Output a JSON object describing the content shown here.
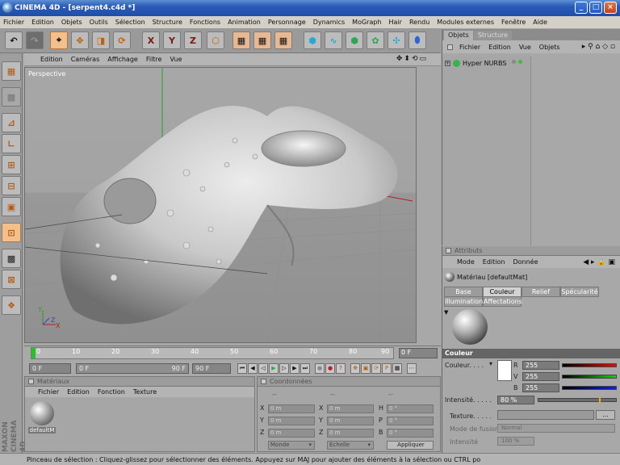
{
  "window": {
    "title": "CINEMA 4D - [serpent4.c4d *]",
    "min": "_",
    "max": "□",
    "close": "×"
  },
  "menubar": [
    "Fichier",
    "Edition",
    "Objets",
    "Outils",
    "Sélection",
    "Structure",
    "Fonctions",
    "Animation",
    "Personnage",
    "Dynamics",
    "MoGraph",
    "Hair",
    "Rendu",
    "Modules externes",
    "Fenêtre",
    "Aide"
  ],
  "toolbar": {
    "x": "X",
    "y": "Y",
    "z": "Z"
  },
  "viewport": {
    "menu": [
      "Edition",
      "Caméras",
      "Affichage",
      "Filtre",
      "Vue"
    ],
    "label": "Perspective",
    "nav": "✥⬍⟲▭"
  },
  "timeline": {
    "ticks": [
      "0",
      "10",
      "20",
      "30",
      "40",
      "50",
      "60",
      "70",
      "80",
      "90"
    ],
    "current_frame": "0 F"
  },
  "transport": {
    "start": "0 F",
    "range_start": "0 F",
    "range_end": "90 F",
    "end": "90 F"
  },
  "materials": {
    "title": "Matériaux",
    "menu": [
      "Fichier",
      "Edition",
      "Fonction",
      "Texture"
    ],
    "item": "defaultM"
  },
  "coords": {
    "title": "Coordonnées",
    "col1": "--",
    "col2": "--",
    "col3": "--",
    "pos": [
      "0 m",
      "0 m",
      "0 m"
    ],
    "size": [
      "0 m",
      "0 m",
      "0 m"
    ],
    "rot": [
      "0 °",
      "0 °",
      "0 °"
    ],
    "labels_left": [
      "X",
      "Y",
      "Z"
    ],
    "labels_mid": [
      "X",
      "Y",
      "Z"
    ],
    "labels_right": [
      "H",
      "P",
      "B"
    ],
    "mode": "Monde",
    "scale": "Echelle",
    "apply": "Appliquer"
  },
  "objects": {
    "tabs": [
      "Objets",
      "Structure"
    ],
    "menu": [
      "Fichier",
      "Edition",
      "Vue",
      "Objets"
    ],
    "item": "Hyper NURBS"
  },
  "attributes": {
    "title": "Attributs",
    "menu": [
      "Mode",
      "Edition",
      "Donnée"
    ],
    "material_name": "Matériau [defaultMat]",
    "tabs_row1": [
      "Base",
      "Couleur",
      "Relief",
      "Spécularité"
    ],
    "tabs_row2": [
      "Illumination",
      "Affectations"
    ],
    "section": "Couleur",
    "color_label": "Couleur. . . .",
    "r_label": "R",
    "v_label": "V",
    "b_label": "B",
    "r": "255",
    "v": "255",
    "b": "255",
    "intensity_label": "Intensité. . . . .",
    "intensity": "80 %",
    "intensity_level": 0.8,
    "texture_label": "Texture. . . . .",
    "texture_btn": "...",
    "blend_label": "Mode de fusion",
    "blend_value": "Normal",
    "blend_int_label": "Intensité",
    "blend_int_value": "100 %"
  },
  "status": "Pinceau de sélection : Cliquez-glissez pour sélectionner des éléments. Appuyez sur MAJ pour ajouter des éléments à la sélection ou CTRL po",
  "brand": "MAXON CINEMA 4D"
}
